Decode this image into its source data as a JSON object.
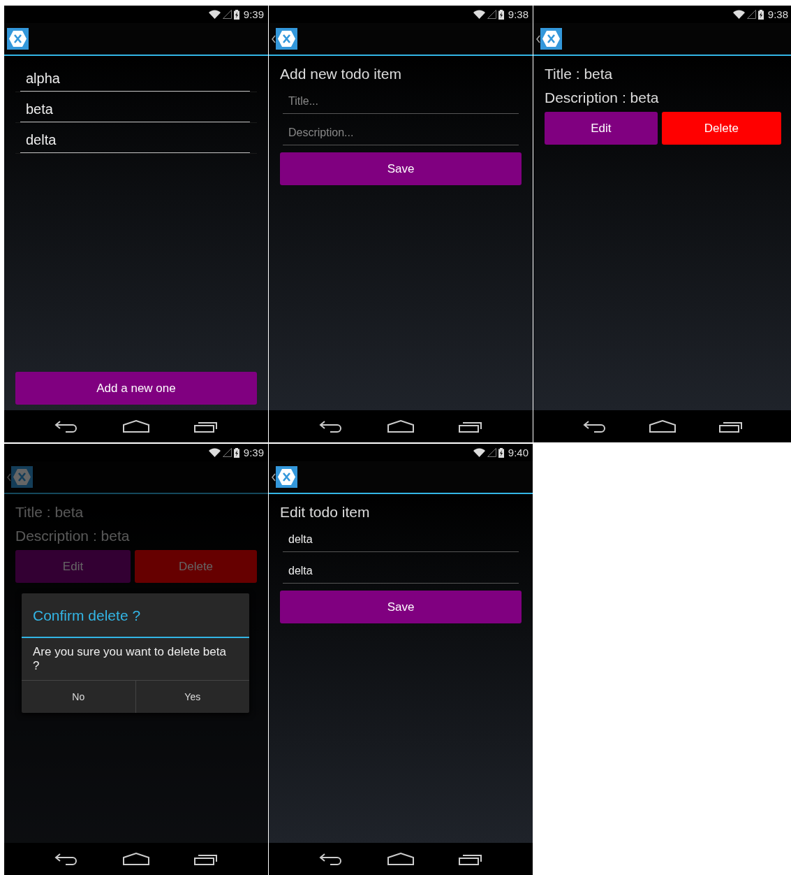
{
  "screens": [
    {
      "kind": "list",
      "time": "9:39",
      "back": false,
      "dimmed": false,
      "items": [
        "alpha",
        "beta",
        "delta"
      ],
      "button": "Add a new one"
    },
    {
      "kind": "form",
      "time": "9:38",
      "back": true,
      "dimmed": false,
      "heading": "Add new todo item",
      "fields": [
        {
          "placeholder": "Title..."
        },
        {
          "placeholder": "Description..."
        }
      ],
      "button": "Save"
    },
    {
      "kind": "detail",
      "time": "9:38",
      "back": true,
      "dimmed": false,
      "lines": [
        "Title : beta",
        "Description : beta"
      ],
      "actions": [
        {
          "label": "Edit",
          "color": "#800080"
        },
        {
          "label": "Delete",
          "color": "#ff0000"
        }
      ]
    },
    {
      "kind": "detail",
      "time": "9:39",
      "back": true,
      "dimmed": true,
      "lines": [
        "Title : beta",
        "Description : beta"
      ],
      "actions": [
        {
          "label": "Edit",
          "color": "#330033"
        },
        {
          "label": "Delete",
          "color": "#660000"
        }
      ],
      "dialog": {
        "title": "Confirm delete ?",
        "message": "Are you sure you want to delete beta ?",
        "buttons": [
          "No",
          "Yes"
        ]
      }
    },
    {
      "kind": "form",
      "time": "9:40",
      "back": true,
      "dimmed": false,
      "heading": "Edit todo item",
      "fields": [
        {
          "value": "delta"
        },
        {
          "value": "delta"
        }
      ],
      "button": "Save"
    }
  ]
}
